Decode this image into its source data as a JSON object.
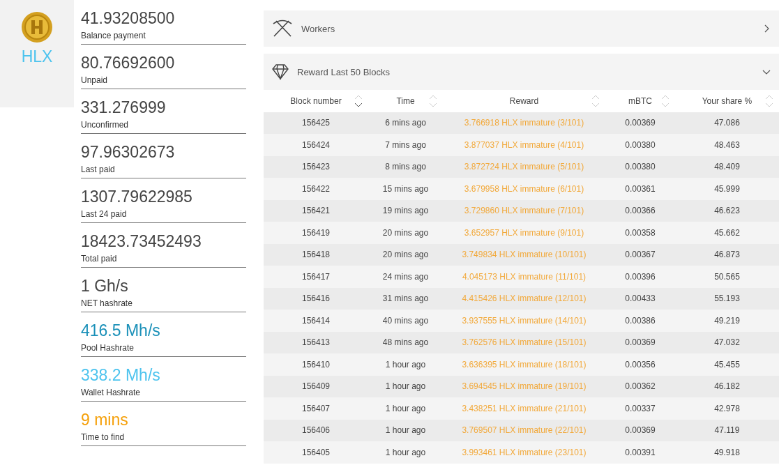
{
  "coin": {
    "symbol": "HLX"
  },
  "stats": [
    {
      "value": "41.93208500",
      "label": "Balance payment",
      "color": "#444444"
    },
    {
      "value": "80.76692600",
      "label": "Unpaid",
      "color": "#444444"
    },
    {
      "value": "331.276999",
      "label": "Unconfirmed",
      "color": "#444444"
    },
    {
      "value": "97.96302673",
      "label": "Last paid",
      "color": "#444444"
    },
    {
      "value": "1307.79622985",
      "label": "Last 24 paid",
      "color": "#444444"
    },
    {
      "value": "18423.73452493",
      "label": "Total paid",
      "color": "#444444"
    },
    {
      "value": "1 Gh/s",
      "label": "NET hashrate",
      "color": "#444444"
    },
    {
      "value": "416.5 Mh/s",
      "label": "Pool Hashrate",
      "color": "#1a90b8"
    },
    {
      "value": "338.2 Mh/s",
      "label": "Wallet Hashrate",
      "color": "#4cc3ee"
    },
    {
      "value": "9 mins",
      "label": "Time to find",
      "color": "#f5a00a"
    }
  ],
  "sections": [
    {
      "kind": "workers",
      "title": "Workers",
      "expanded": false
    },
    {
      "kind": "rewards",
      "title": "Reward Last 50 Blocks",
      "expanded": true
    }
  ],
  "table": {
    "columns": [
      {
        "label": "Block number",
        "sorted": true
      },
      {
        "label": "Time",
        "sorted": false
      },
      {
        "label": "Reward",
        "sorted": false
      },
      {
        "label": "mBTC",
        "sorted": false
      },
      {
        "label": "Your share %",
        "sorted": false
      }
    ],
    "rows": [
      [
        "156425",
        "6 mins ago",
        "3.766918 HLX immature (3/101)",
        "0.00369",
        "47.086"
      ],
      [
        "156424",
        "7 mins ago",
        "3.877037 HLX immature (4/101)",
        "0.00380",
        "48.463"
      ],
      [
        "156423",
        "8 mins ago",
        "3.872724 HLX immature (5/101)",
        "0.00380",
        "48.409"
      ],
      [
        "156422",
        "15 mins ago",
        "3.679958 HLX immature (6/101)",
        "0.00361",
        "45.999"
      ],
      [
        "156421",
        "19 mins ago",
        "3.729860 HLX immature (7/101)",
        "0.00366",
        "46.623"
      ],
      [
        "156419",
        "20 mins ago",
        "3.652957 HLX immature (9/101)",
        "0.00358",
        "45.662"
      ],
      [
        "156418",
        "20 mins ago",
        "3.749834 HLX immature (10/101)",
        "0.00367",
        "46.873"
      ],
      [
        "156417",
        "24 mins ago",
        "4.045173 HLX immature (11/101)",
        "0.00396",
        "50.565"
      ],
      [
        "156416",
        "31 mins ago",
        "4.415426 HLX immature (12/101)",
        "0.00433",
        "55.193"
      ],
      [
        "156414",
        "40 mins ago",
        "3.937555 HLX immature (14/101)",
        "0.00386",
        "49.219"
      ],
      [
        "156413",
        "48 mins ago",
        "3.762576 HLX immature (15/101)",
        "0.00369",
        "47.032"
      ],
      [
        "156410",
        "1 hour ago",
        "3.636395 HLX immature (18/101)",
        "0.00356",
        "45.455"
      ],
      [
        "156409",
        "1 hour ago",
        "3.694545 HLX immature (19/101)",
        "0.00362",
        "46.182"
      ],
      [
        "156407",
        "1 hour ago",
        "3.438251 HLX immature (21/101)",
        "0.00337",
        "42.978"
      ],
      [
        "156406",
        "1 hour ago",
        "3.769507 HLX immature (22/101)",
        "0.00369",
        "47.119"
      ],
      [
        "156405",
        "1 hour ago",
        "3.993461 HLX immature (23/101)",
        "0.00391",
        "49.918"
      ]
    ]
  }
}
